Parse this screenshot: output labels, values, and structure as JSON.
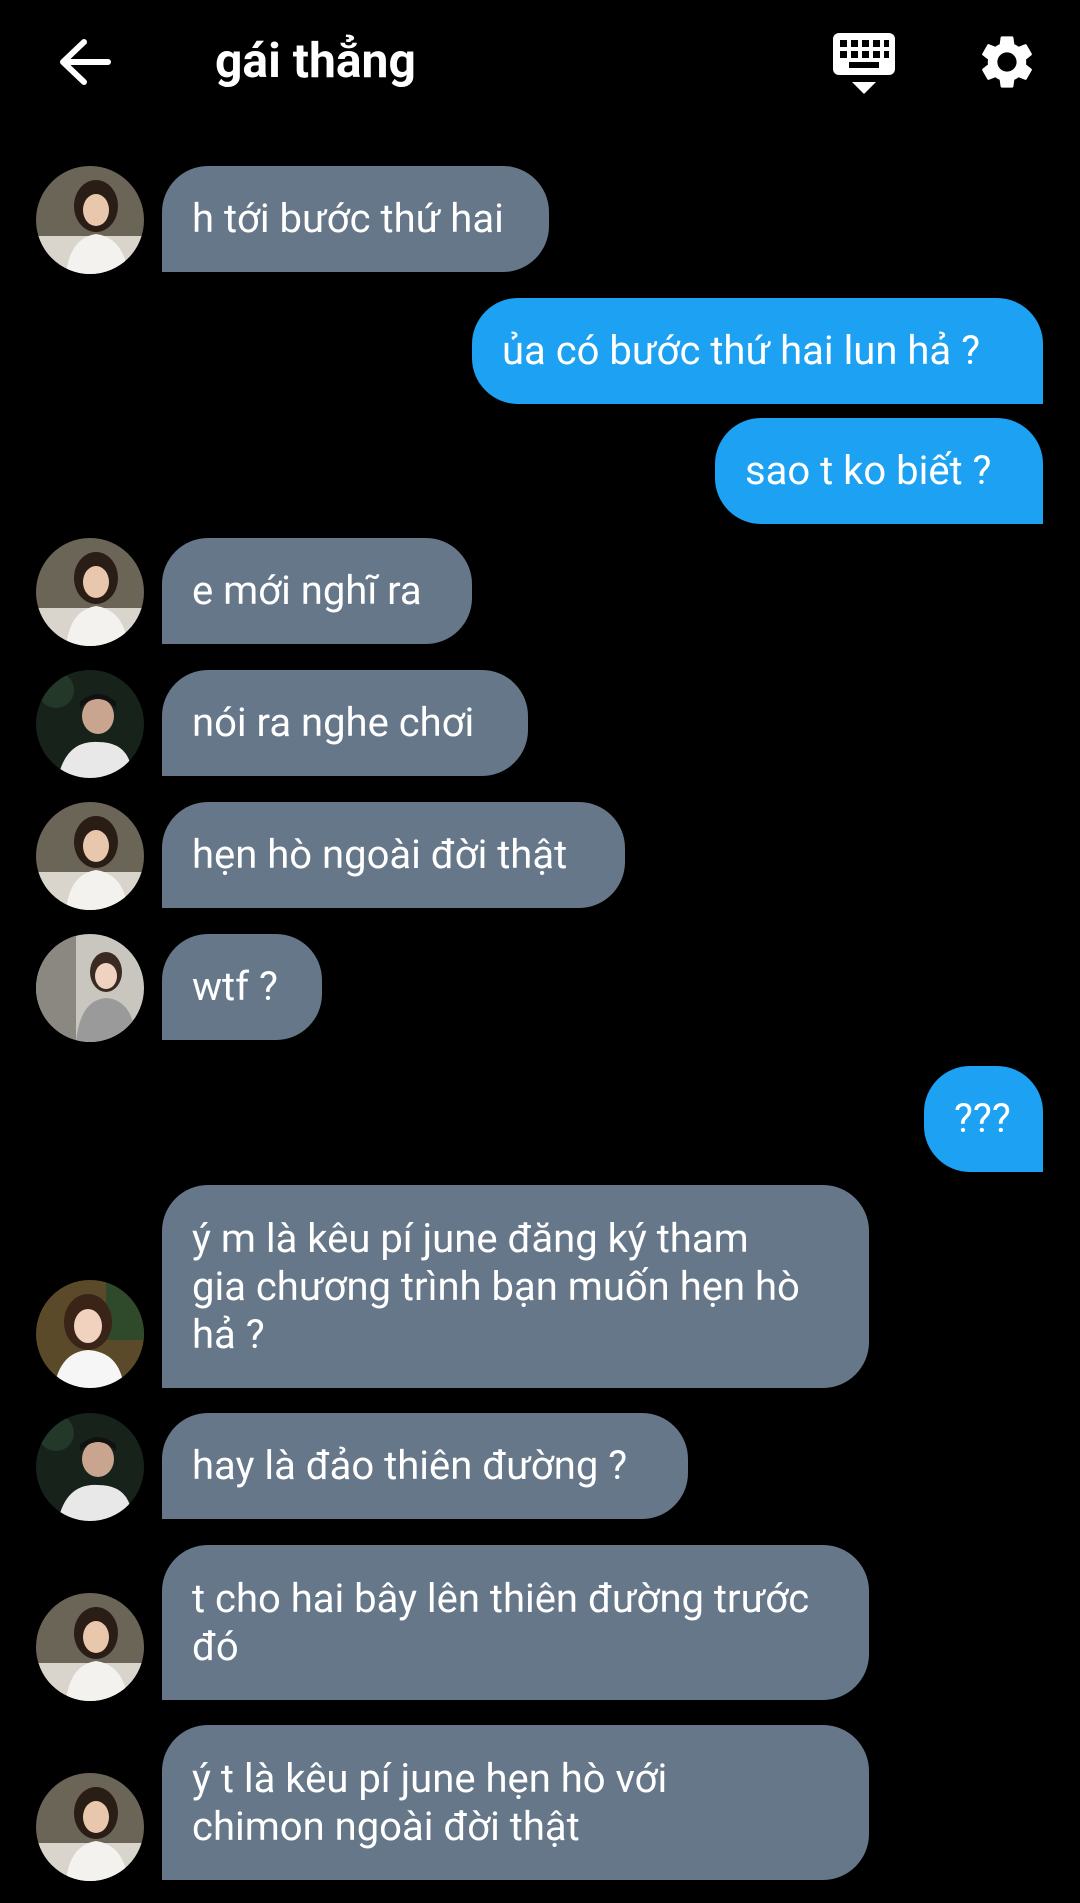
{
  "header": {
    "title": "gái thẳng",
    "back_icon": "arrow-left-icon",
    "keyboard_icon": "keyboard-hide-icon",
    "settings_icon": "gear-icon"
  },
  "colors": {
    "background": "#000000",
    "incoming_bubble": "#66778a",
    "outgoing_bubble": "#1da1f2",
    "text": "#ffffff"
  },
  "messages": [
    {
      "direction": "in",
      "sender": "A",
      "text": "h tới bước thứ hai"
    },
    {
      "direction": "out",
      "text": "ủa có bước thứ hai lun hả ?"
    },
    {
      "direction": "out",
      "text": "sao t ko biết ?"
    },
    {
      "direction": "in",
      "sender": "A",
      "text": "e mới nghĩ ra"
    },
    {
      "direction": "in",
      "sender": "B",
      "text": "nói ra nghe chơi"
    },
    {
      "direction": "in",
      "sender": "A",
      "text": "hẹn hò ngoài đời thật"
    },
    {
      "direction": "in",
      "sender": "C",
      "text": "wtf ?"
    },
    {
      "direction": "out",
      "text": "???"
    },
    {
      "direction": "in",
      "sender": "D",
      "text": "ý m là kêu pí june đăng ký tham\ngia chương trình bạn muốn hẹn hò\nhả ?"
    },
    {
      "direction": "in",
      "sender": "B",
      "text": "hay là đảo thiên đường ?"
    },
    {
      "direction": "in",
      "sender": "A",
      "text": "t cho hai bây lên thiên đường trước\nđó"
    },
    {
      "direction": "in",
      "sender": "A",
      "text": "ý t là kêu pí june hẹn hò với\nchimon ngoài đời thật"
    }
  ]
}
